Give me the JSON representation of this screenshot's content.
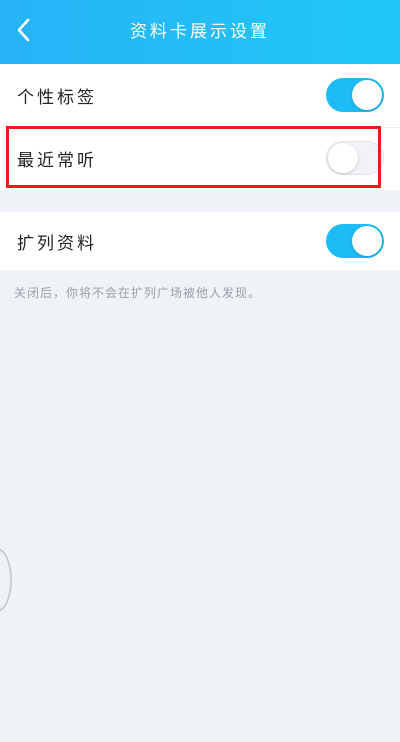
{
  "header": {
    "title": "资料卡展示设置",
    "back_icon": "chevron-left-icon"
  },
  "settings": {
    "items": [
      {
        "label": "个性标签",
        "enabled": true
      },
      {
        "label": "最近常听",
        "enabled": false
      },
      {
        "label": "扩列资料",
        "enabled": true
      }
    ]
  },
  "hint": "关闭后，你将不会在扩列广场被他人发现。",
  "colors": {
    "header_gradient_start": "#27b3f7",
    "header_gradient_end": "#1fc8f6",
    "toggle_on": "#1ebcf5",
    "toggle_off": "#f2f3f6",
    "highlight": "#f01a1a",
    "background": "#eff2f6"
  }
}
